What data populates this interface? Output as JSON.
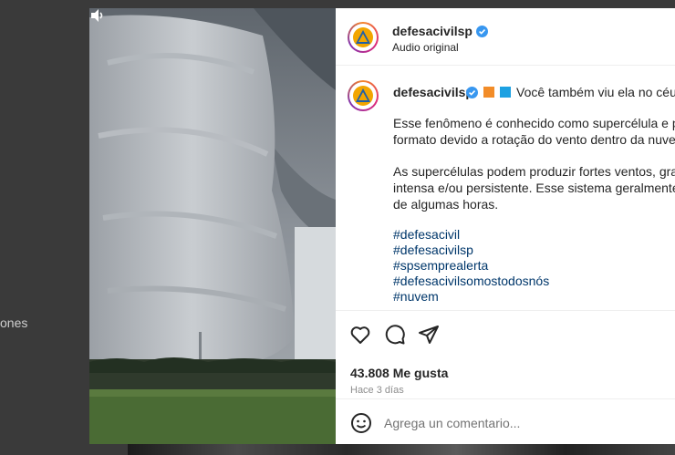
{
  "background": {
    "partial_text": "ones"
  },
  "post": {
    "username": "defesacivilsp",
    "audio_label": "Audio original",
    "caption": {
      "username": "defesacivilsp",
      "first_line": "Você também viu ela no céu h",
      "paragraphs": [
        [
          "Esse fenômeno é conhecido como supercélula e poss",
          "formato devido a rotação do vento dentro da nuvem"
        ],
        [
          "As supercélulas podem produzir fortes ventos, graniz",
          "intensa e/ou persistente. Esse sistema geralmente ter",
          "de algumas horas."
        ]
      ],
      "hashtags": [
        "#defesacivil",
        "#defesacivilsp",
        "#spsemprealerta",
        "#defesacivilsomostodosnós",
        "#nuvem"
      ]
    },
    "likes": "43.808 Me gusta",
    "time_ago": "Hace 3 días",
    "comment_placeholder": "Agrega un comentario..."
  },
  "icons": {
    "verified": "verified-badge-icon",
    "like": "heart-icon",
    "comment": "comment-icon",
    "share": "paper-plane-icon",
    "emoji": "emoji-icon",
    "volume": "volume-icon",
    "orange_square": "orange-square-emoji",
    "blue_square": "blue-square-emoji"
  },
  "colors": {
    "verified_blue": "#3897f0",
    "hashtag": "#00376b",
    "orange_square": "#f28c28",
    "blue_square": "#1da1e2"
  }
}
